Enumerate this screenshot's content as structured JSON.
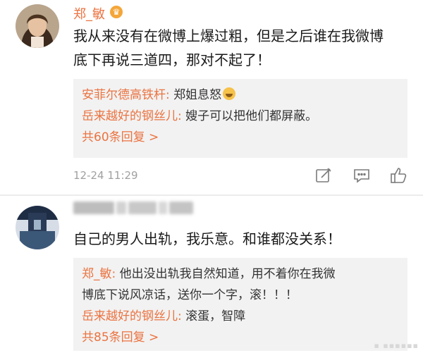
{
  "comments": [
    {
      "username": "郑_敏",
      "vip_icon": "vip-badge-icon",
      "text_line1": "我从来没有在微博上爆过粗，但是之后谁在我微博",
      "text_line2": "底下再说三道四，那对不起了！",
      "replies": [
        {
          "name": "安菲尔德高铁杆:",
          "text": " 郑姐息怒"
        },
        {
          "name": "岳来越好的钢丝儿:",
          "text": " 嫂子可以把他们都屏蔽。"
        }
      ],
      "more_replies": "共60条回复 >",
      "time": "12-24 11:29"
    },
    {
      "username": "",
      "text_line1": "自己的男人出轨，我乐意。和谁都没关系！",
      "replies": [
        {
          "name": "郑_敏:",
          "text": " 他出没出轨我自然知道，用不着你在我微",
          "text2": "博底下说风凉话，送你一个字，滚！！！"
        },
        {
          "name": "岳来越好的钢丝儿:",
          "text": " 滚蛋，智障"
        }
      ],
      "more_replies": "共85条回复 >"
    }
  ],
  "icons": {
    "edit": "edit-icon",
    "comment": "comment-icon",
    "like": "thumbs-up-icon"
  },
  "colors": {
    "username": "#eb7340",
    "reply_bg": "#f2f2f2",
    "time": "#a0a0a0"
  }
}
